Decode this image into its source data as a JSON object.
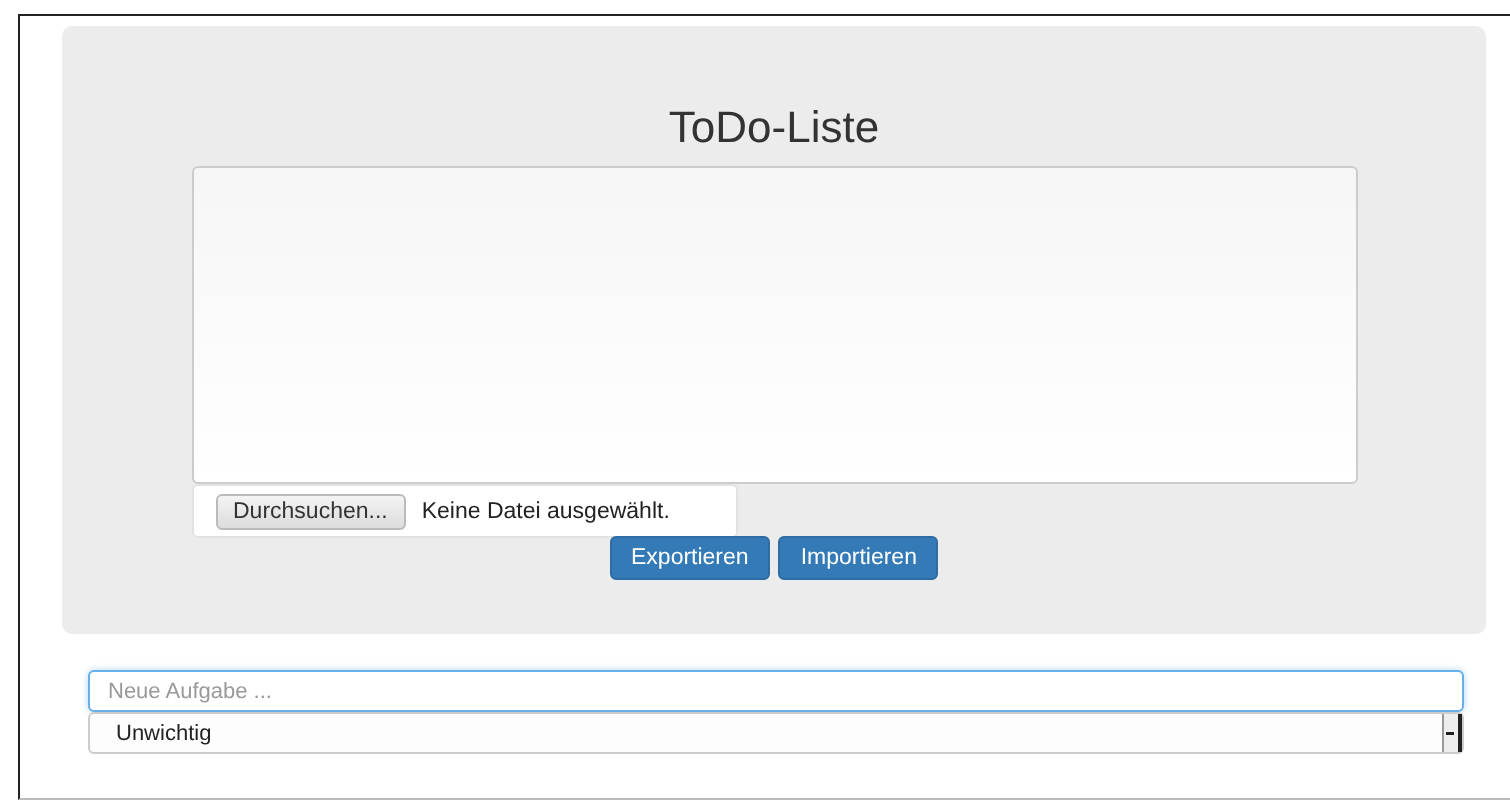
{
  "title": "ToDo-Liste",
  "file_input": {
    "button": "Durchsuchen...",
    "status": "Keine Datei ausgewählt."
  },
  "buttons": [
    "Exportieren",
    "Importieren"
  ],
  "new_task": {
    "placeholder": "Neue Aufgabe ..."
  },
  "priority": {
    "value": "Unwichtig"
  }
}
